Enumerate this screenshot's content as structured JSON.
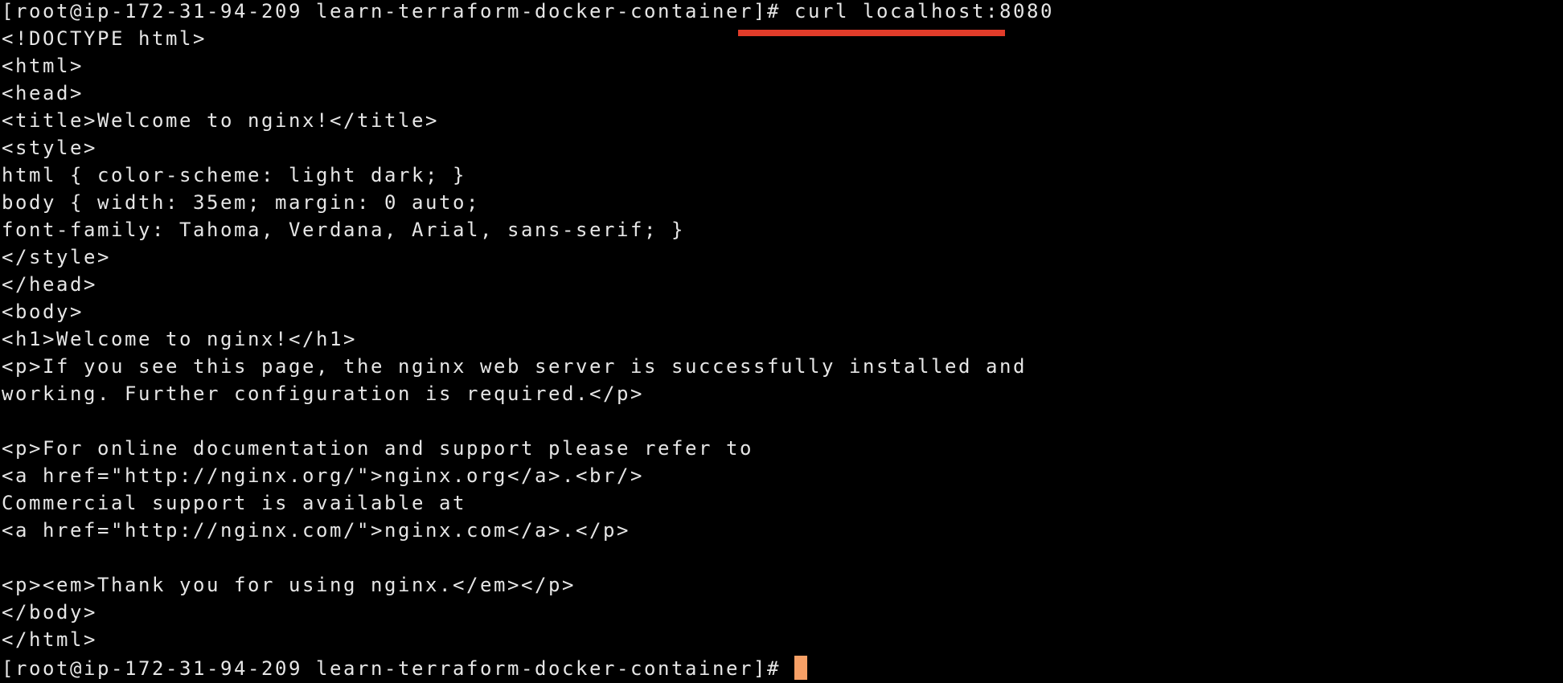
{
  "terminal": {
    "prompt": "[root@ip-172-31-94-209 learn-terraform-docker-container]# ",
    "command": "curl localhost:8080",
    "output_lines": [
      "<!DOCTYPE html>",
      "<html>",
      "<head>",
      "<title>Welcome to nginx!</title>",
      "<style>",
      "html { color-scheme: light dark; }",
      "body { width: 35em; margin: 0 auto;",
      "font-family: Tahoma, Verdana, Arial, sans-serif; }",
      "</style>",
      "</head>",
      "<body>",
      "<h1>Welcome to nginx!</h1>",
      "<p>If you see this page, the nginx web server is successfully installed and",
      "working. Further configuration is required.</p>",
      "",
      "<p>For online documentation and support please refer to",
      "<a href=\"http://nginx.org/\">nginx.org</a>.<br/>",
      "Commercial support is available at",
      "<a href=\"http://nginx.com/\">nginx.com</a>.</p>",
      "",
      "<p><em>Thank you for using nginx.</em></p>",
      "</body>",
      "</html>"
    ],
    "final_prompt": "[root@ip-172-31-94-209 learn-terraform-docker-container]# "
  },
  "colors": {
    "background": "#000000",
    "text": "#e6e6e6",
    "annotation_underline": "#e23c2a",
    "cursor": "#f7a066"
  }
}
